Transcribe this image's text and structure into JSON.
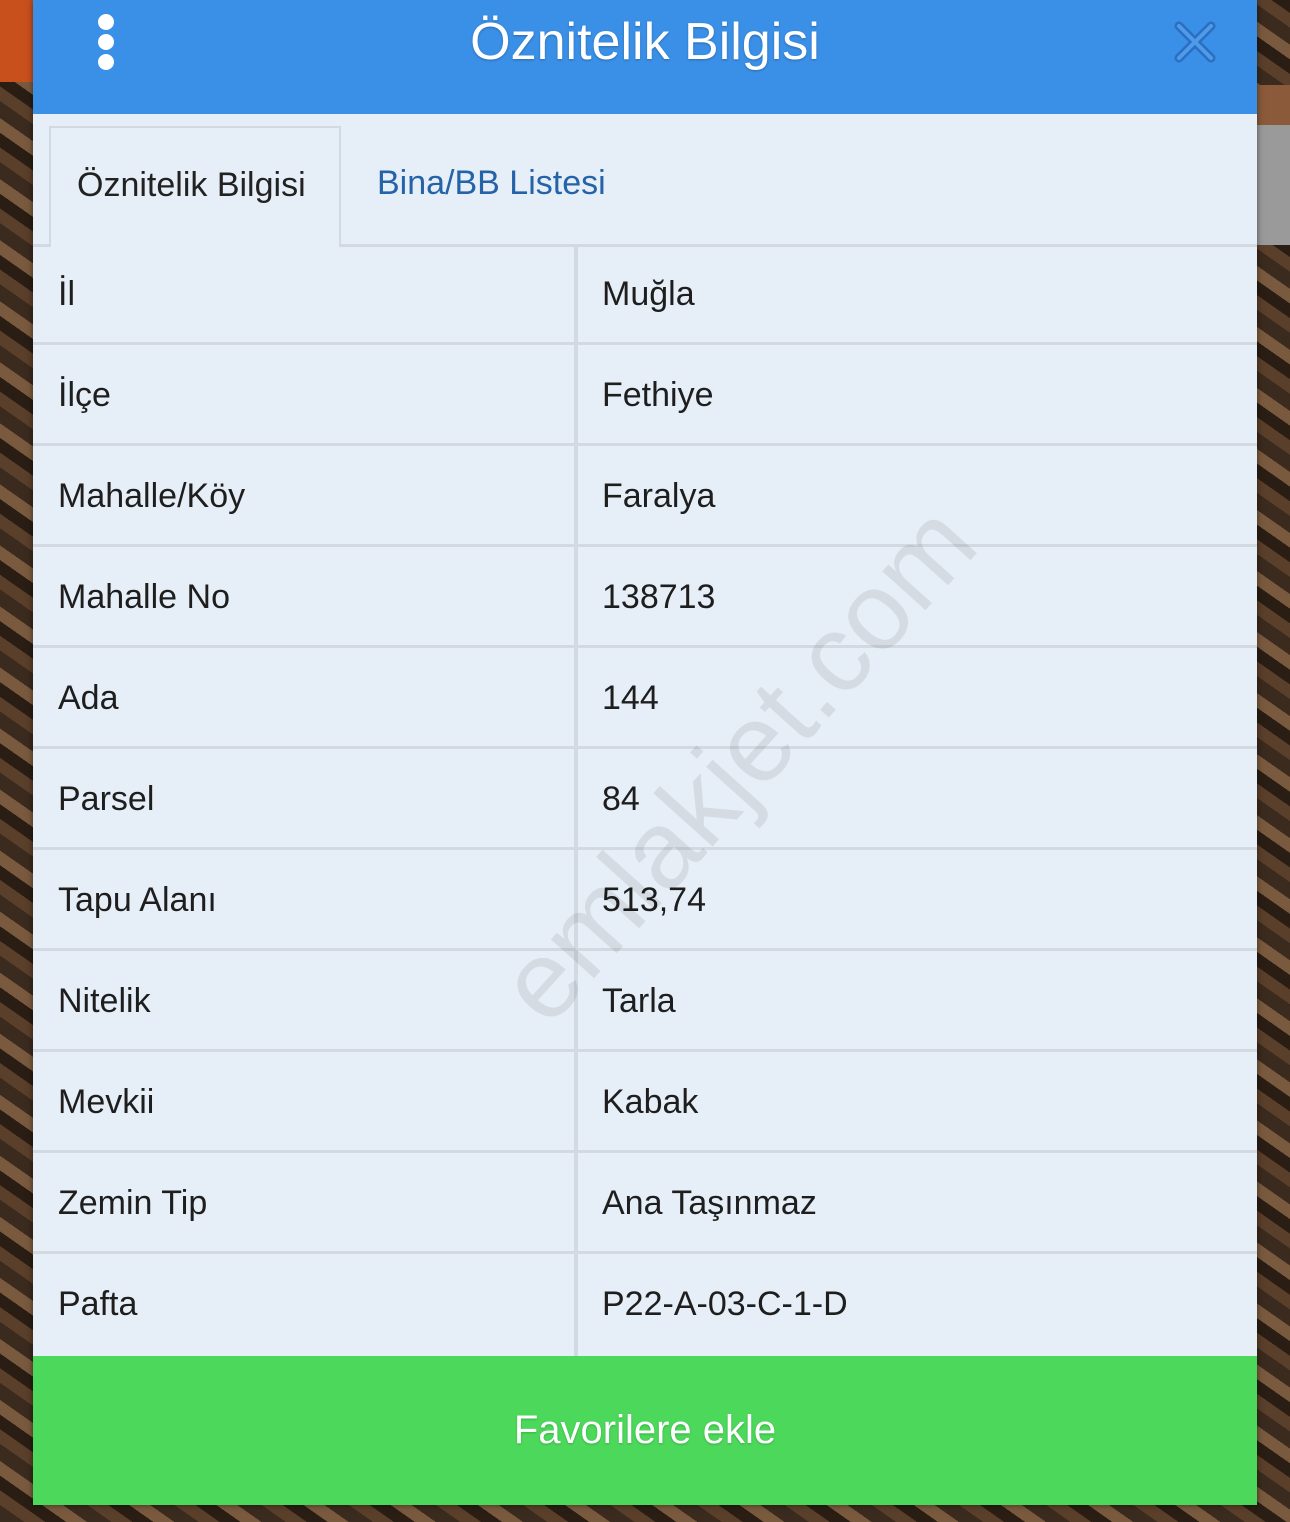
{
  "dialog": {
    "title": "Öznitelik Bilgisi"
  },
  "tabs": [
    {
      "label": "Öznitelik Bilgisi",
      "active": true
    },
    {
      "label": "Bina/BB Listesi",
      "active": false
    }
  ],
  "attributes": [
    {
      "label": "İl",
      "value": "Muğla"
    },
    {
      "label": "İlçe",
      "value": "Fethiye"
    },
    {
      "label": "Mahalle/Köy",
      "value": "Faralya"
    },
    {
      "label": "Mahalle No",
      "value": "138713"
    },
    {
      "label": "Ada",
      "value": "144"
    },
    {
      "label": "Parsel",
      "value": "84"
    },
    {
      "label": "Tapu Alanı",
      "value": "513,74"
    },
    {
      "label": "Nitelik",
      "value": "Tarla"
    },
    {
      "label": "Mevkii",
      "value": "Kabak"
    },
    {
      "label": "Zemin Tip",
      "value": "Ana Taşınmaz"
    },
    {
      "label": "Pafta",
      "value": "P22-A-03-C-1-D"
    }
  ],
  "watermark": "emlakjet.com",
  "actions": {
    "favorite_label": "Favorilere ekle"
  },
  "colors": {
    "title_bar": "#3a8fe6",
    "panel": "#e6eef7",
    "favorite_button": "#4cd85a",
    "tab_link": "#2563a8"
  },
  "icons": {
    "menu": "more-vertical-icon",
    "close": "close-icon"
  }
}
